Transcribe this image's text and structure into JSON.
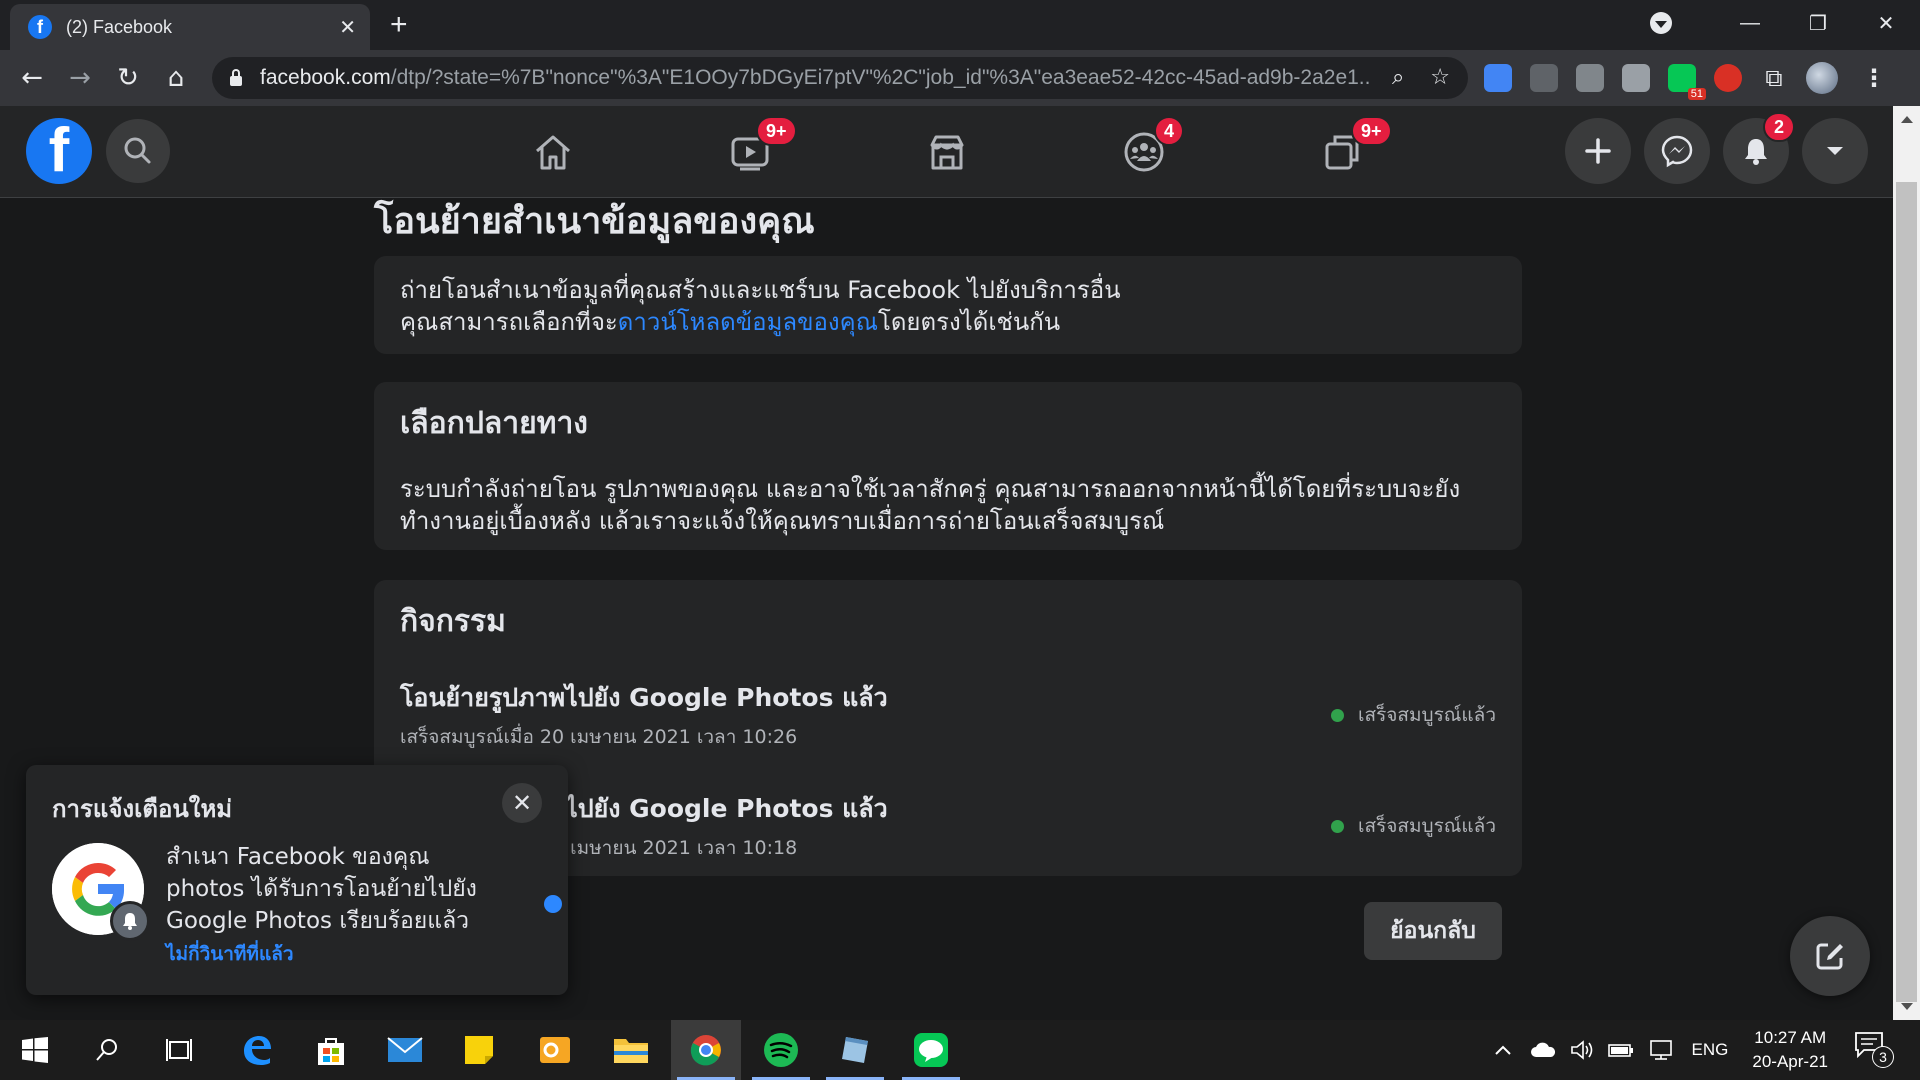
{
  "browser": {
    "tab_title": "(2) Facebook",
    "tab_favicon": "f",
    "url_host": "facebook.com",
    "url_path": "/dtp/?state=%7B\"nonce\"%3A\"E1OOy7bDGyEi7ptV\"%2C\"job_id\"%3A\"ea3eae52-42cc-45ad-ad9b-2a2e1...",
    "ext_badge": "51"
  },
  "fb_header": {
    "logo": "f",
    "badges": {
      "watch": "9+",
      "groups": "4",
      "gaming": "9+",
      "notifications": "2"
    }
  },
  "page": {
    "title": "โอนย้ายสำเนาข้อมูลของคุณ",
    "intro_line1": "ถ่ายโอนสำเนาข้อมูลที่คุณสร้างและแชร์บน Facebook ไปยังบริการอื่น",
    "intro_line2_prefix": "คุณสามารถเลือกที่จะ",
    "intro_link": "ดาวน์โหลดข้อมูลของคุณ",
    "intro_line2_suffix": "โดยตรงได้เช่นกัน",
    "dest_heading": "เลือกปลายทาง",
    "dest_body": "ระบบกำลังถ่ายโอน รูปภาพของคุณ และอาจใช้เวลาสักครู่ คุณสามารถออกจากหน้านี้ได้โดยที่ระบบจะยังทำงานอยู่เบื้องหลัง แล้วเราจะแจ้งให้คุณทราบเมื่อการถ่ายโอนเสร็จสมบูรณ์",
    "activity_heading": "กิจกรรม",
    "activities": [
      {
        "title": "โอนย้ายรูปภาพไปยัง Google Photos แล้ว",
        "subtitle": "เสร็จสมบูรณ์เมื่อ 20 เมษายน 2021 เวลา 10:26",
        "status": "เสร็จสมบูรณ์แล้ว"
      },
      {
        "title": "โอนย้ายรูปภาพไปยัง Google Photos แล้ว",
        "subtitle": "เสร็จสมบูรณ์เมื่อ 20 เมษายน 2021 เวลา 10:18",
        "status": "เสร็จสมบูรณ์แล้ว"
      }
    ],
    "back_button": "ย้อนกลับ"
  },
  "toast": {
    "heading": "การแจ้งเตือนใหม่",
    "message": "สำเนา Facebook ของคุณ photos ได้รับการโอนย้ายไปยัง Google Photos เรียบร้อยแล้ว",
    "time": "ไม่กี่วินาทีที่แล้ว"
  },
  "taskbar": {
    "language": "ENG",
    "time": "10:27 AM",
    "date": "20-Apr-21",
    "notification_count": "3"
  },
  "colors": {
    "fb_blue": "#1877f2",
    "link_blue": "#2d88ff",
    "badge_red": "#e41e3f",
    "status_green": "#31a24c"
  }
}
